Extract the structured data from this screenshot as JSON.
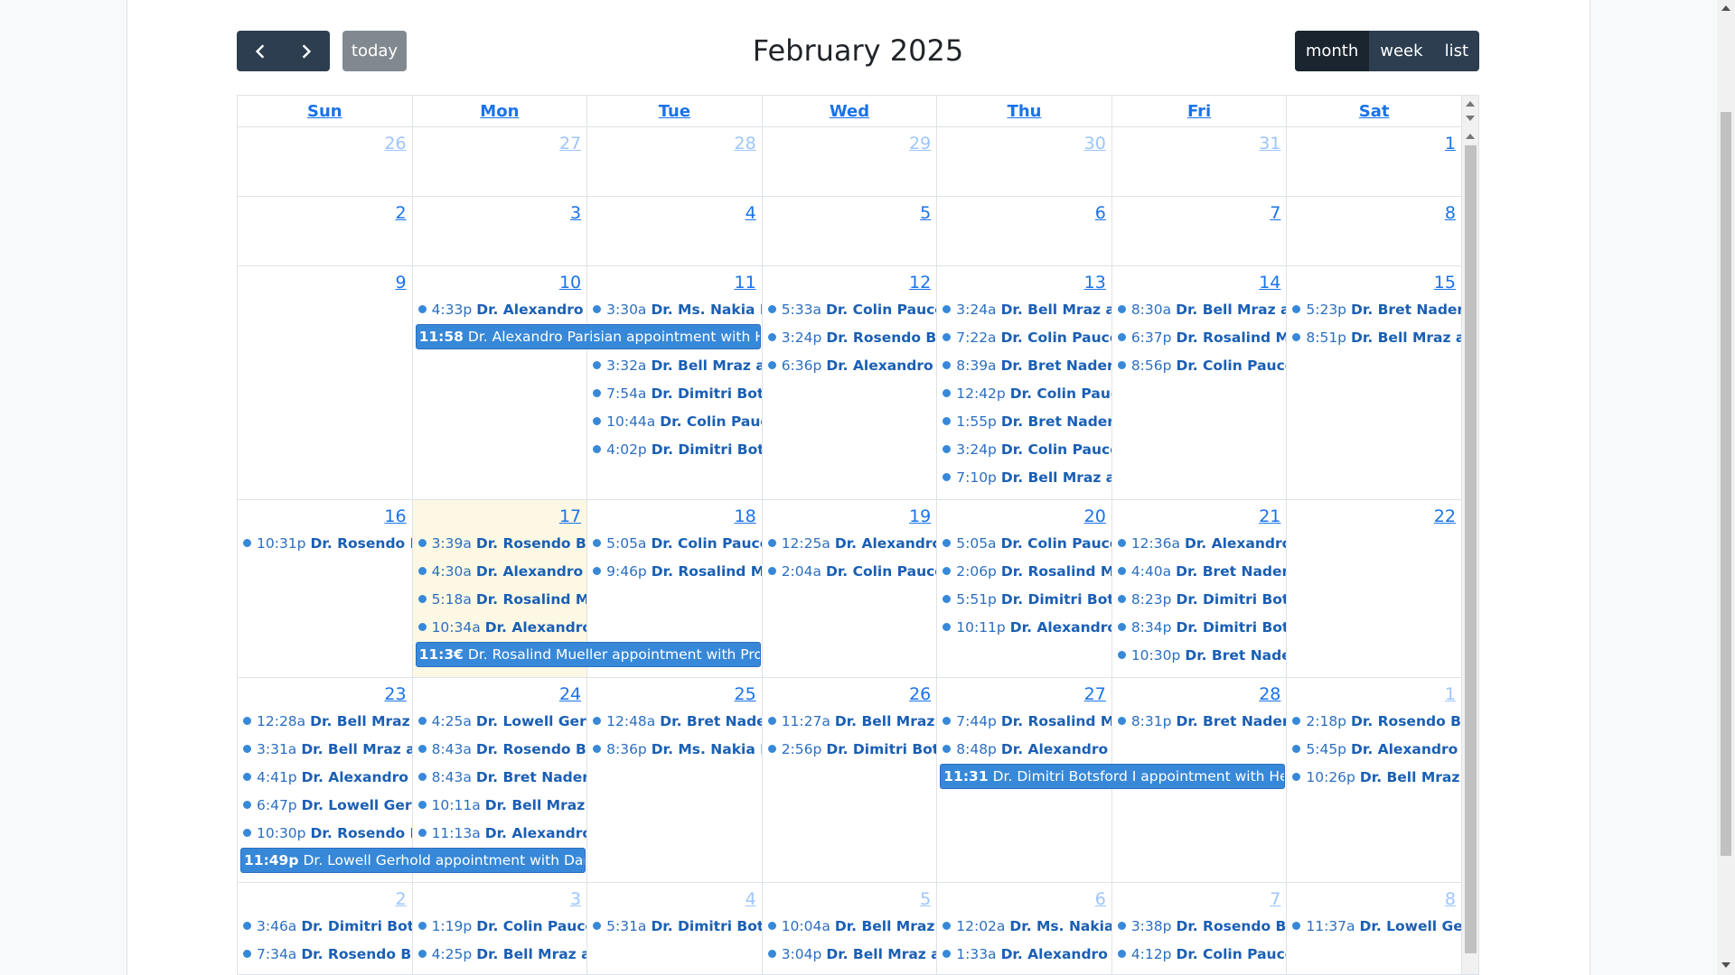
{
  "toolbar": {
    "title": "February 2025",
    "today_label": "today",
    "prev_icon": "chevron-left-icon",
    "next_icon": "chevron-right-icon",
    "views": [
      {
        "label": "month",
        "active": true
      },
      {
        "label": "week",
        "active": false
      },
      {
        "label": "list",
        "active": false
      }
    ]
  },
  "colors": {
    "event": "#3788d8",
    "today_bg": "#fcf8e3",
    "toolbar": "#2c3e50"
  },
  "headers": [
    "Sun",
    "Mon",
    "Tue",
    "Wed",
    "Thu",
    "Fri",
    "Sat"
  ],
  "weeks": [
    {
      "height": 77,
      "days": [
        {
          "num": "26",
          "other": true,
          "events": []
        },
        {
          "num": "27",
          "other": true,
          "events": []
        },
        {
          "num": "28",
          "other": true,
          "events": []
        },
        {
          "num": "29",
          "other": true,
          "events": []
        },
        {
          "num": "30",
          "other": true,
          "events": []
        },
        {
          "num": "31",
          "other": true,
          "events": []
        },
        {
          "num": "1",
          "events": []
        }
      ]
    },
    {
      "height": 77,
      "days": [
        {
          "num": "2",
          "events": []
        },
        {
          "num": "3",
          "events": []
        },
        {
          "num": "4",
          "events": []
        },
        {
          "num": "5",
          "events": []
        },
        {
          "num": "6",
          "events": []
        },
        {
          "num": "7",
          "events": []
        },
        {
          "num": "8",
          "events": []
        }
      ]
    },
    {
      "height": 259,
      "days": [
        {
          "num": "9",
          "events": []
        },
        {
          "num": "10",
          "events": [
            {
              "time": "4:33p",
              "title": "Dr. Alexandro Par"
            }
          ]
        },
        {
          "num": "11",
          "events": [
            {
              "time": "3:30a",
              "title": "Dr. Ms. Nakia Bart"
            },
            {
              "spacer": true
            },
            {
              "time": "3:32a",
              "title": "Dr. Bell Mraz appc"
            },
            {
              "time": "7:54a",
              "title": "Dr. Dimitri Botsfor"
            },
            {
              "time": "10:44a",
              "title": "Dr. Colin Paucek"
            },
            {
              "time": "4:02p",
              "title": "Dr. Dimitri Botsfor"
            }
          ]
        },
        {
          "num": "12",
          "events": [
            {
              "time": "5:33a",
              "title": "Dr. Colin Paucek a"
            },
            {
              "time": "3:24p",
              "title": "Dr. Rosendo Bauc"
            },
            {
              "time": "6:36p",
              "title": "Dr. Alexandro Pari"
            }
          ]
        },
        {
          "num": "13",
          "events": [
            {
              "time": "3:24a",
              "title": "Dr. Bell Mraz appc"
            },
            {
              "time": "7:22a",
              "title": "Dr. Colin Paucek a"
            },
            {
              "time": "8:39a",
              "title": "Dr. Bret Nader app"
            },
            {
              "time": "12:42p",
              "title": "Dr. Colin Paucek"
            },
            {
              "time": "1:55p",
              "title": "Dr. Bret Nader app"
            },
            {
              "time": "3:24p",
              "title": "Dr. Colin Paucek a"
            },
            {
              "time": "7:10p",
              "title": "Dr. Bell Mraz appc"
            }
          ]
        },
        {
          "num": "14",
          "events": [
            {
              "time": "8:30a",
              "title": "Dr. Bell Mraz appc"
            },
            {
              "time": "6:37p",
              "title": "Dr. Rosalind Muell"
            },
            {
              "time": "8:56p",
              "title": "Dr. Colin Paucek a"
            }
          ]
        },
        {
          "num": "15",
          "events": [
            {
              "time": "5:23p",
              "title": "Dr. Bret Nader app"
            },
            {
              "time": "8:51p",
              "title": "Dr. Bell Mraz appc"
            }
          ]
        }
      ],
      "block": {
        "col": 1,
        "span": 2,
        "time": "11:58",
        "title": "Dr. Alexandro Parisian appointment with Hettie I",
        "row": 1
      }
    },
    {
      "height": 197,
      "days": [
        {
          "num": "16",
          "events": [
            {
              "time": "10:31p",
              "title": "Dr. Rosendo Bau"
            }
          ]
        },
        {
          "num": "17",
          "today": true,
          "events": [
            {
              "time": "3:39a",
              "title": "Dr. Rosendo Baucl"
            },
            {
              "time": "4:30a",
              "title": "Dr. Alexandro Pari"
            },
            {
              "time": "5:18a",
              "title": "Dr. Rosalind Muell"
            },
            {
              "time": "10:34a",
              "title": "Dr. Alexandro Pa"
            }
          ]
        },
        {
          "num": "18",
          "events": [
            {
              "time": "5:05a",
              "title": "Dr. Colin Paucek a"
            },
            {
              "time": "9:46p",
              "title": "Dr. Rosalind Muell"
            }
          ]
        },
        {
          "num": "19",
          "events": [
            {
              "time": "12:25a",
              "title": "Dr. Alexandro Pa"
            },
            {
              "time": "2:04a",
              "title": "Dr. Colin Paucek a"
            }
          ]
        },
        {
          "num": "20",
          "events": [
            {
              "time": "5:05a",
              "title": "Dr. Colin Paucek a"
            },
            {
              "time": "2:06p",
              "title": "Dr. Rosalind Muell"
            },
            {
              "time": "5:51p",
              "title": "Dr. Dimitri Botsfor"
            },
            {
              "time": "10:11p",
              "title": "Dr. Alexandro Pa"
            }
          ]
        },
        {
          "num": "21",
          "events": [
            {
              "time": "12:36a",
              "title": "Dr. Alexandro Pa"
            },
            {
              "time": "4:40a",
              "title": "Dr. Bret Nader app"
            },
            {
              "time": "8:23p",
              "title": "Dr. Dimitri Botsfor"
            },
            {
              "time": "8:34p",
              "title": "Dr. Dimitri Botsfor"
            },
            {
              "time": "10:30p",
              "title": "Dr. Bret Nader ap"
            }
          ]
        },
        {
          "num": "22",
          "events": []
        }
      ],
      "block": {
        "col": 1,
        "span": 2,
        "time": "11:3€",
        "title": "Dr. Rosalind Mueller appointment with Prof. Mely",
        "row": 4
      }
    },
    {
      "height": 227,
      "days": [
        {
          "num": "23",
          "events": [
            {
              "time": "12:28a",
              "title": "Dr. Bell Mraz app"
            },
            {
              "time": "3:31a",
              "title": "Dr. Bell Mraz appc"
            },
            {
              "time": "4:41p",
              "title": "Dr. Alexandro Pari"
            },
            {
              "time": "6:47p",
              "title": "Dr. Lowell Gerhol"
            },
            {
              "time": "10:30p",
              "title": "Dr. Rosendo Bau"
            }
          ]
        },
        {
          "num": "24",
          "events": [
            {
              "time": "4:25a",
              "title": "Dr. Lowell Gerhol"
            },
            {
              "time": "8:43a",
              "title": "Dr. Rosendo Baucl"
            },
            {
              "time": "8:43a",
              "title": "Dr. Bret Nader app"
            },
            {
              "time": "10:11a",
              "title": "Dr. Bell Mraz app"
            },
            {
              "time": "11:13a",
              "title": "Dr. Alexandro Pa"
            }
          ]
        },
        {
          "num": "25",
          "events": [
            {
              "time": "12:48a",
              "title": "Dr. Bret Nader ap"
            },
            {
              "time": "8:36p",
              "title": "Dr. Ms. Nakia Bart"
            }
          ]
        },
        {
          "num": "26",
          "events": [
            {
              "time": "11:27a",
              "title": "Dr. Bell Mraz app"
            },
            {
              "time": "2:56p",
              "title": "Dr. Dimitri Botsfor"
            }
          ]
        },
        {
          "num": "27",
          "events": [
            {
              "time": "7:44p",
              "title": "Dr. Rosalind Muell"
            },
            {
              "time": "8:48p",
              "title": "Dr. Alexandro Pari"
            }
          ]
        },
        {
          "num": "28",
          "events": [
            {
              "time": "8:31p",
              "title": "Dr. Bret Nader app"
            }
          ]
        },
        {
          "num": "1",
          "other": true,
          "events": [
            {
              "time": "2:18p",
              "title": "Dr. Rosendo Baucl"
            },
            {
              "time": "5:45p",
              "title": "Dr. Alexandro Pari"
            },
            {
              "time": "10:26p",
              "title": "Dr. Bell Mraz app"
            }
          ]
        }
      ],
      "blocks": [
        {
          "col": 0,
          "span": 2,
          "time": "11:49p",
          "title": "Dr. Lowell Gerhold appointment with Dariana K",
          "row": 5
        },
        {
          "col": 4,
          "span": 2,
          "time": "11:31",
          "title": "Dr. Dimitri Botsford I appointment with Hettie H",
          "row": 2
        }
      ]
    },
    {
      "height": 110,
      "days": [
        {
          "num": "2",
          "other": true,
          "events": [
            {
              "time": "3:46a",
              "title": "Dr. Dimitri Botsfor"
            },
            {
              "time": "7:34a",
              "title": "Dr. Rosendo Baucl"
            }
          ]
        },
        {
          "num": "3",
          "other": true,
          "events": [
            {
              "time": "1:19p",
              "title": "Dr. Colin Paucek a"
            },
            {
              "time": "4:25p",
              "title": "Dr. Bell Mraz appc"
            }
          ]
        },
        {
          "num": "4",
          "other": true,
          "events": [
            {
              "time": "5:31a",
              "title": "Dr. Dimitri Botsfor"
            }
          ]
        },
        {
          "num": "5",
          "other": true,
          "events": [
            {
              "time": "10:04a",
              "title": "Dr. Bell Mraz app"
            },
            {
              "time": "3:04p",
              "title": "Dr. Bell Mraz appc"
            }
          ]
        },
        {
          "num": "6",
          "other": true,
          "events": [
            {
              "time": "12:02a",
              "title": "Dr. Ms. Nakia Bai"
            },
            {
              "time": "1:33a",
              "title": "Dr. Alexandro Pari"
            }
          ]
        },
        {
          "num": "7",
          "other": true,
          "events": [
            {
              "time": "3:38p",
              "title": "Dr. Rosendo Bauc"
            },
            {
              "time": "4:12p",
              "title": "Dr. Colin Paucek a"
            }
          ]
        },
        {
          "num": "8",
          "other": true,
          "events": [
            {
              "time": "11:37a",
              "title": "Dr. Lowell Gerho"
            }
          ]
        }
      ]
    }
  ]
}
